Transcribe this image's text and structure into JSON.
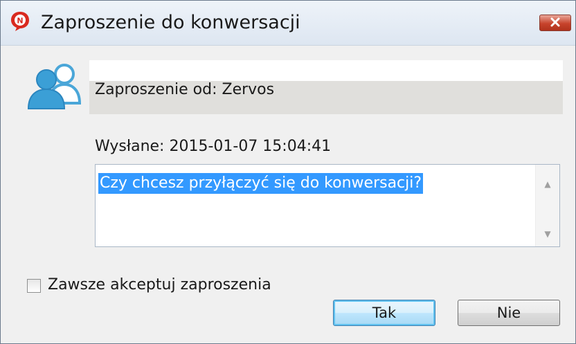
{
  "window": {
    "title": "Zaproszenie do konwersacji",
    "app_icon": "chat-bubble-n-icon",
    "close_icon": "close-x-icon"
  },
  "header": {
    "icon": "users-icon",
    "from_text": "Zaproszenie od: Zervos"
  },
  "details": {
    "sent_text": "Wysłane: 2015-01-07 15:04:41"
  },
  "message": {
    "text": "Czy chcesz przyłączyć się do konwersacji?"
  },
  "options": {
    "always_accept_label": "Zawsze akceptuj zaproszenia",
    "always_accept_checked": false
  },
  "buttons": {
    "yes_label": "Tak",
    "no_label": "Nie"
  },
  "colors": {
    "selection": "#3399ff",
    "close_button": "#c7432c",
    "icon_blue": "#4aa6d8"
  }
}
